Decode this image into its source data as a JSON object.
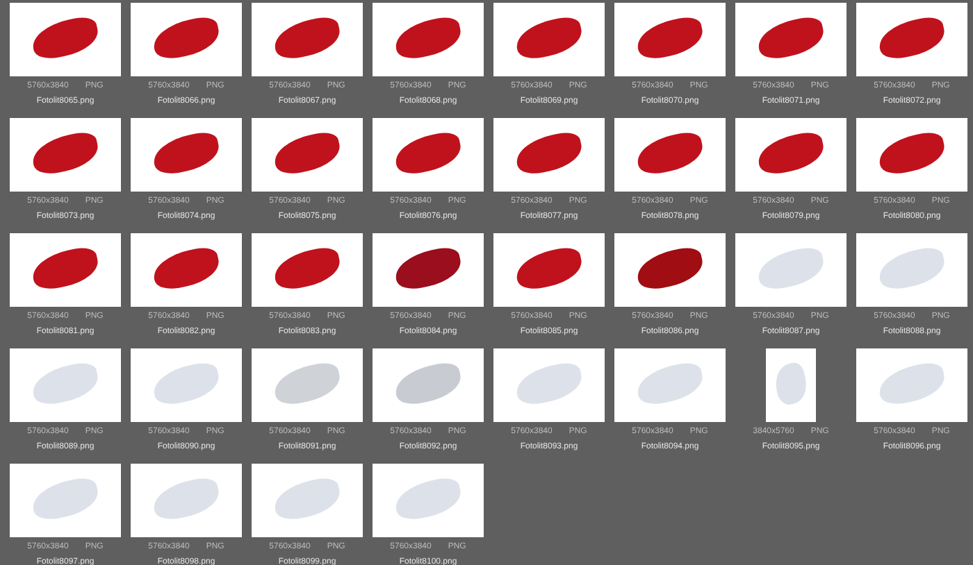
{
  "files": [
    {
      "name": "Fotolit8065.png",
      "dimensions": "5760x3840",
      "format": "PNG",
      "kind": "landscape",
      "color": "#c0121c"
    },
    {
      "name": "Fotolit8066.png",
      "dimensions": "5760x3840",
      "format": "PNG",
      "kind": "landscape",
      "color": "#c0121c"
    },
    {
      "name": "Fotolit8067.png",
      "dimensions": "5760x3840",
      "format": "PNG",
      "kind": "landscape",
      "color": "#c0121c"
    },
    {
      "name": "Fotolit8068.png",
      "dimensions": "5760x3840",
      "format": "PNG",
      "kind": "landscape",
      "color": "#c0121c"
    },
    {
      "name": "Fotolit8069.png",
      "dimensions": "5760x3840",
      "format": "PNG",
      "kind": "landscape",
      "color": "#c0121c"
    },
    {
      "name": "Fotolit8070.png",
      "dimensions": "5760x3840",
      "format": "PNG",
      "kind": "landscape",
      "color": "#c0121c"
    },
    {
      "name": "Fotolit8071.png",
      "dimensions": "5760x3840",
      "format": "PNG",
      "kind": "landscape",
      "color": "#c0121c"
    },
    {
      "name": "Fotolit8072.png",
      "dimensions": "5760x3840",
      "format": "PNG",
      "kind": "landscape",
      "color": "#c0121c"
    },
    {
      "name": "Fotolit8073.png",
      "dimensions": "5760x3840",
      "format": "PNG",
      "kind": "landscape",
      "color": "#c0121c"
    },
    {
      "name": "Fotolit8074.png",
      "dimensions": "5760x3840",
      "format": "PNG",
      "kind": "landscape",
      "color": "#c0121c"
    },
    {
      "name": "Fotolit8075.png",
      "dimensions": "5760x3840",
      "format": "PNG",
      "kind": "landscape",
      "color": "#c0121c"
    },
    {
      "name": "Fotolit8076.png",
      "dimensions": "5760x3840",
      "format": "PNG",
      "kind": "landscape",
      "color": "#c0121c"
    },
    {
      "name": "Fotolit8077.png",
      "dimensions": "5760x3840",
      "format": "PNG",
      "kind": "landscape",
      "color": "#c0121c"
    },
    {
      "name": "Fotolit8078.png",
      "dimensions": "5760x3840",
      "format": "PNG",
      "kind": "landscape",
      "color": "#c0121c"
    },
    {
      "name": "Fotolit8079.png",
      "dimensions": "5760x3840",
      "format": "PNG",
      "kind": "landscape",
      "color": "#c0121c"
    },
    {
      "name": "Fotolit8080.png",
      "dimensions": "5760x3840",
      "format": "PNG",
      "kind": "landscape",
      "color": "#c0121c"
    },
    {
      "name": "Fotolit8081.png",
      "dimensions": "5760x3840",
      "format": "PNG",
      "kind": "landscape",
      "color": "#c0121c"
    },
    {
      "name": "Fotolit8082.png",
      "dimensions": "5760x3840",
      "format": "PNG",
      "kind": "landscape",
      "color": "#c0121c"
    },
    {
      "name": "Fotolit8083.png",
      "dimensions": "5760x3840",
      "format": "PNG",
      "kind": "landscape",
      "color": "#c0121c"
    },
    {
      "name": "Fotolit8084.png",
      "dimensions": "5760x3840",
      "format": "PNG",
      "kind": "landscape",
      "color": "#9a0e1e"
    },
    {
      "name": "Fotolit8085.png",
      "dimensions": "5760x3840",
      "format": "PNG",
      "kind": "landscape",
      "color": "#c0121c"
    },
    {
      "name": "Fotolit8086.png",
      "dimensions": "5760x3840",
      "format": "PNG",
      "kind": "landscape",
      "color": "#a00d12"
    },
    {
      "name": "Fotolit8087.png",
      "dimensions": "5760x3840",
      "format": "PNG",
      "kind": "landscape",
      "color": "#dde2ea"
    },
    {
      "name": "Fotolit8088.png",
      "dimensions": "5760x3840",
      "format": "PNG",
      "kind": "landscape",
      "color": "#dde2ea"
    },
    {
      "name": "Fotolit8089.png",
      "dimensions": "5760x3840",
      "format": "PNG",
      "kind": "landscape",
      "color": "#dde2ea"
    },
    {
      "name": "Fotolit8090.png",
      "dimensions": "5760x3840",
      "format": "PNG",
      "kind": "landscape",
      "color": "#dde2ea"
    },
    {
      "name": "Fotolit8091.png",
      "dimensions": "5760x3840",
      "format": "PNG",
      "kind": "landscape",
      "color": "#cfd3d8"
    },
    {
      "name": "Fotolit8092.png",
      "dimensions": "5760x3840",
      "format": "PNG",
      "kind": "landscape",
      "color": "#c8ccd2"
    },
    {
      "name": "Fotolit8093.png",
      "dimensions": "5760x3840",
      "format": "PNG",
      "kind": "landscape",
      "color": "#dde2ea"
    },
    {
      "name": "Fotolit8094.png",
      "dimensions": "5760x3840",
      "format": "PNG",
      "kind": "landscape",
      "color": "#dde2ea"
    },
    {
      "name": "Fotolit8095.png",
      "dimensions": "3840x5760",
      "format": "PNG",
      "kind": "portrait",
      "color": "#dde2ea"
    },
    {
      "name": "Fotolit8096.png",
      "dimensions": "5760x3840",
      "format": "PNG",
      "kind": "landscape",
      "color": "#dde2ea"
    },
    {
      "name": "Fotolit8097.png",
      "dimensions": "5760x3840",
      "format": "PNG",
      "kind": "landscape",
      "color": "#dde2ea"
    },
    {
      "name": "Fotolit8098.png",
      "dimensions": "5760x3840",
      "format": "PNG",
      "kind": "landscape",
      "color": "#dde2ea"
    },
    {
      "name": "Fotolit8099.png",
      "dimensions": "5760x3840",
      "format": "PNG",
      "kind": "landscape",
      "color": "#dde2ea"
    },
    {
      "name": "Fotolit8100.png",
      "dimensions": "5760x3840",
      "format": "PNG",
      "kind": "landscape",
      "color": "#dde2ea"
    }
  ]
}
